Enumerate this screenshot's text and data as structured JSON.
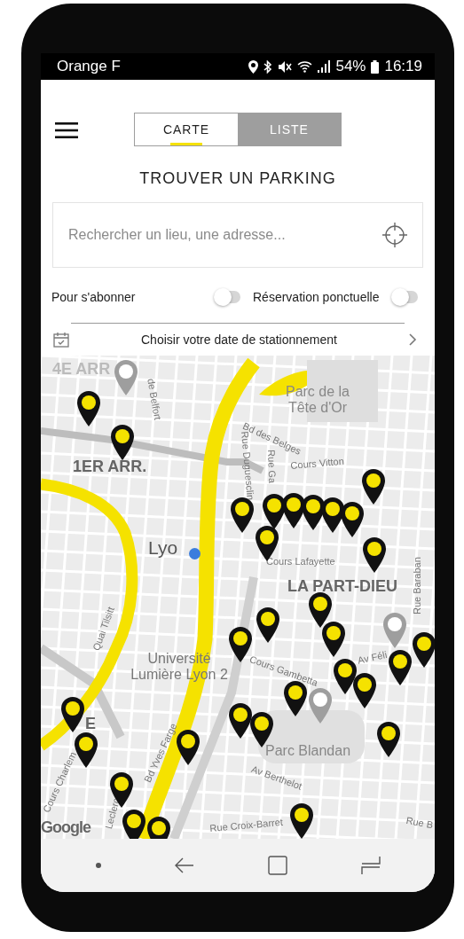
{
  "status_bar": {
    "carrier": "Orange F",
    "battery": "54%",
    "time": "16:19"
  },
  "header": {
    "tabs": [
      {
        "label": "CARTE",
        "selected": true
      },
      {
        "label": "LISTE",
        "selected": false
      }
    ],
    "title": "TROUVER UN PARKING"
  },
  "search": {
    "placeholder": "Rechercher un lieu, une adresse..."
  },
  "filters": [
    {
      "label": "Pour s'abonner",
      "on": false
    },
    {
      "label": "Réservation ponctuelle",
      "on": false
    }
  ],
  "date_picker": {
    "label": "Choisir votre date de stationnement"
  },
  "map": {
    "labels": [
      {
        "text": "4E ARR",
        "kind": "district"
      },
      {
        "text": "de Belfort",
        "kind": "street"
      },
      {
        "text": "Parc de la Tête d'Or",
        "kind": "place"
      },
      {
        "text": "Bd des Belges",
        "kind": "street"
      },
      {
        "text": "Rue Duguesclin",
        "kind": "street"
      },
      {
        "text": "Rue Ga",
        "kind": "street"
      },
      {
        "text": "Cours Vitton",
        "kind": "street"
      },
      {
        "text": "1ER ARR.",
        "kind": "district"
      },
      {
        "text": "Lyo",
        "kind": "city"
      },
      {
        "text": "Cours Lafayette",
        "kind": "street"
      },
      {
        "text": "LA PART-DIEU",
        "kind": "district"
      },
      {
        "text": "Rue Baraban",
        "kind": "street"
      },
      {
        "text": "Quai Tilsitt",
        "kind": "street"
      },
      {
        "text": "Université Lumière Lyon 2",
        "kind": "place"
      },
      {
        "text": "Cours Gambetta",
        "kind": "street"
      },
      {
        "text": "Av Féli",
        "kind": "street"
      },
      {
        "text": "E",
        "kind": "district"
      },
      {
        "text": "Parc Blandan",
        "kind": "place"
      },
      {
        "text": "Av Berthelot",
        "kind": "street"
      },
      {
        "text": "Cours Charlem",
        "kind": "street"
      },
      {
        "text": "Bd Yves Farge",
        "kind": "street"
      },
      {
        "text": "Leclerc",
        "kind": "street"
      },
      {
        "text": "Rue Croix-Barret",
        "kind": "street"
      },
      {
        "text": "Rue B",
        "kind": "street"
      }
    ],
    "pins": [
      {
        "color": "#9e9e9e"
      },
      {
        "color": "#111111"
      },
      {
        "color": "#111111"
      },
      {
        "color": "#111111"
      },
      {
        "color": "#111111"
      },
      {
        "color": "#111111"
      },
      {
        "color": "#111111"
      },
      {
        "color": "#111111"
      },
      {
        "color": "#111111"
      },
      {
        "color": "#111111"
      },
      {
        "color": "#111111"
      },
      {
        "color": "#111111"
      },
      {
        "color": "#111111"
      },
      {
        "color": "#111111"
      },
      {
        "color": "#111111"
      },
      {
        "color": "#111111"
      },
      {
        "color": "#9e9e9e"
      },
      {
        "color": "#111111"
      },
      {
        "color": "#111111"
      },
      {
        "color": "#111111"
      },
      {
        "color": "#111111"
      },
      {
        "color": "#111111"
      },
      {
        "color": "#9e9e9e"
      },
      {
        "color": "#111111"
      },
      {
        "color": "#111111"
      },
      {
        "color": "#111111"
      },
      {
        "color": "#111111"
      },
      {
        "color": "#111111"
      },
      {
        "color": "#111111"
      },
      {
        "color": "#111111"
      },
      {
        "color": "#111111"
      },
      {
        "color": "#111111"
      },
      {
        "color": "#111111"
      }
    ],
    "logo": "Google"
  }
}
